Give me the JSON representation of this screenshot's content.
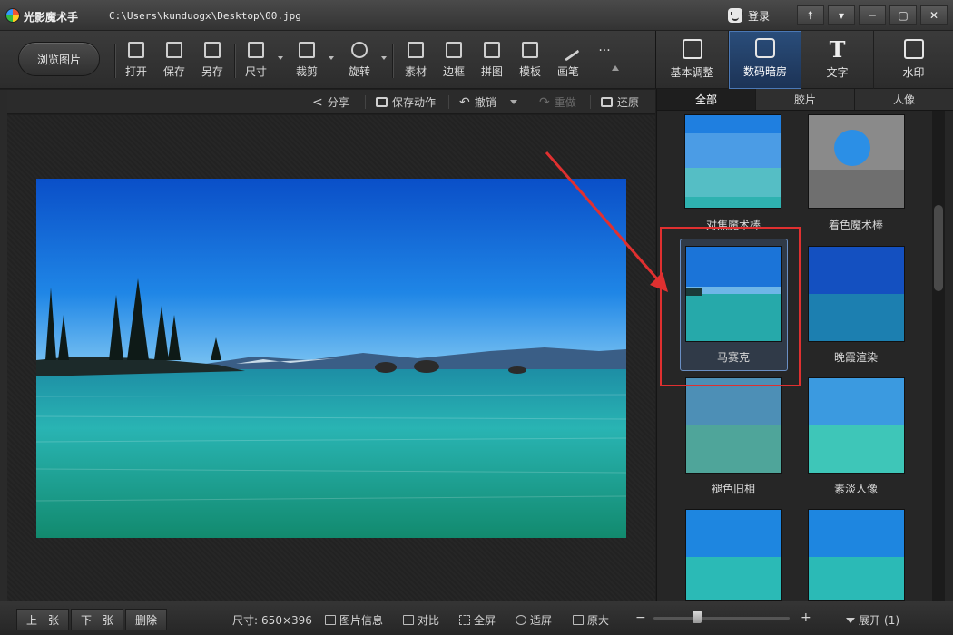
{
  "titlebar": {
    "app_name": "光影魔术手",
    "file_path": "C:\\Users\\kunduogx\\Desktop\\00.jpg",
    "login_label": "登录",
    "buttons": [
      "⯭",
      "▾",
      "─",
      "▢",
      "✕"
    ]
  },
  "toolbar": {
    "browse_label": "浏览图片",
    "tools": [
      {
        "label": "打开",
        "icon": "open-image-icon"
      },
      {
        "label": "保存",
        "icon": "save-icon"
      },
      {
        "label": "另存",
        "icon": "save-as-icon"
      },
      {
        "label": "尺寸",
        "icon": "resize-icon"
      },
      {
        "label": "裁剪",
        "icon": "crop-icon"
      },
      {
        "label": "旋转",
        "icon": "rotate-icon"
      },
      {
        "label": "素材",
        "icon": "material-icon"
      },
      {
        "label": "边框",
        "icon": "border-icon"
      },
      {
        "label": "拼图",
        "icon": "collage-icon"
      },
      {
        "label": "模板",
        "icon": "template-icon"
      },
      {
        "label": "画笔",
        "icon": "brush-icon"
      },
      {
        "label": "···",
        "icon": "more-icon"
      }
    ]
  },
  "right_tabs": [
    {
      "label": "基本调整",
      "icon": "basic-adjust-icon"
    },
    {
      "label": "数码暗房",
      "icon": "darkroom-camera-icon"
    },
    {
      "label": "文字",
      "icon": "text-T-icon"
    },
    {
      "label": "水印",
      "icon": "watermark-icon"
    }
  ],
  "actionbar": {
    "share": "分享",
    "save_action": "保存动作",
    "undo": "撤销",
    "redo": "重做",
    "restore": "还原"
  },
  "filter_panel": {
    "subtabs": [
      "全部",
      "胶片",
      "人像"
    ],
    "filters": [
      {
        "label": "对焦魔术棒"
      },
      {
        "label": "着色魔术棒"
      },
      {
        "label": "马赛克"
      },
      {
        "label": "晚霞渲染"
      },
      {
        "label": "褪色旧相"
      },
      {
        "label": "素淡人像"
      },
      {
        "label": ""
      },
      {
        "label": ""
      }
    ],
    "selected_filter": "马赛克"
  },
  "statusbar": {
    "prev": "上一张",
    "next": "下一张",
    "delete": "删除",
    "size_label": "尺寸:",
    "size_value": "650×396",
    "info": "图片信息",
    "compare": "对比",
    "fullscreen": "全屏",
    "fit": "适屏",
    "original": "原大",
    "zoom_minus": "−",
    "zoom_plus": "+",
    "expand": "展开",
    "expand_count": "(1)"
  },
  "colors": {
    "accent": "#2a4d7a",
    "highlight": "#e03030"
  }
}
